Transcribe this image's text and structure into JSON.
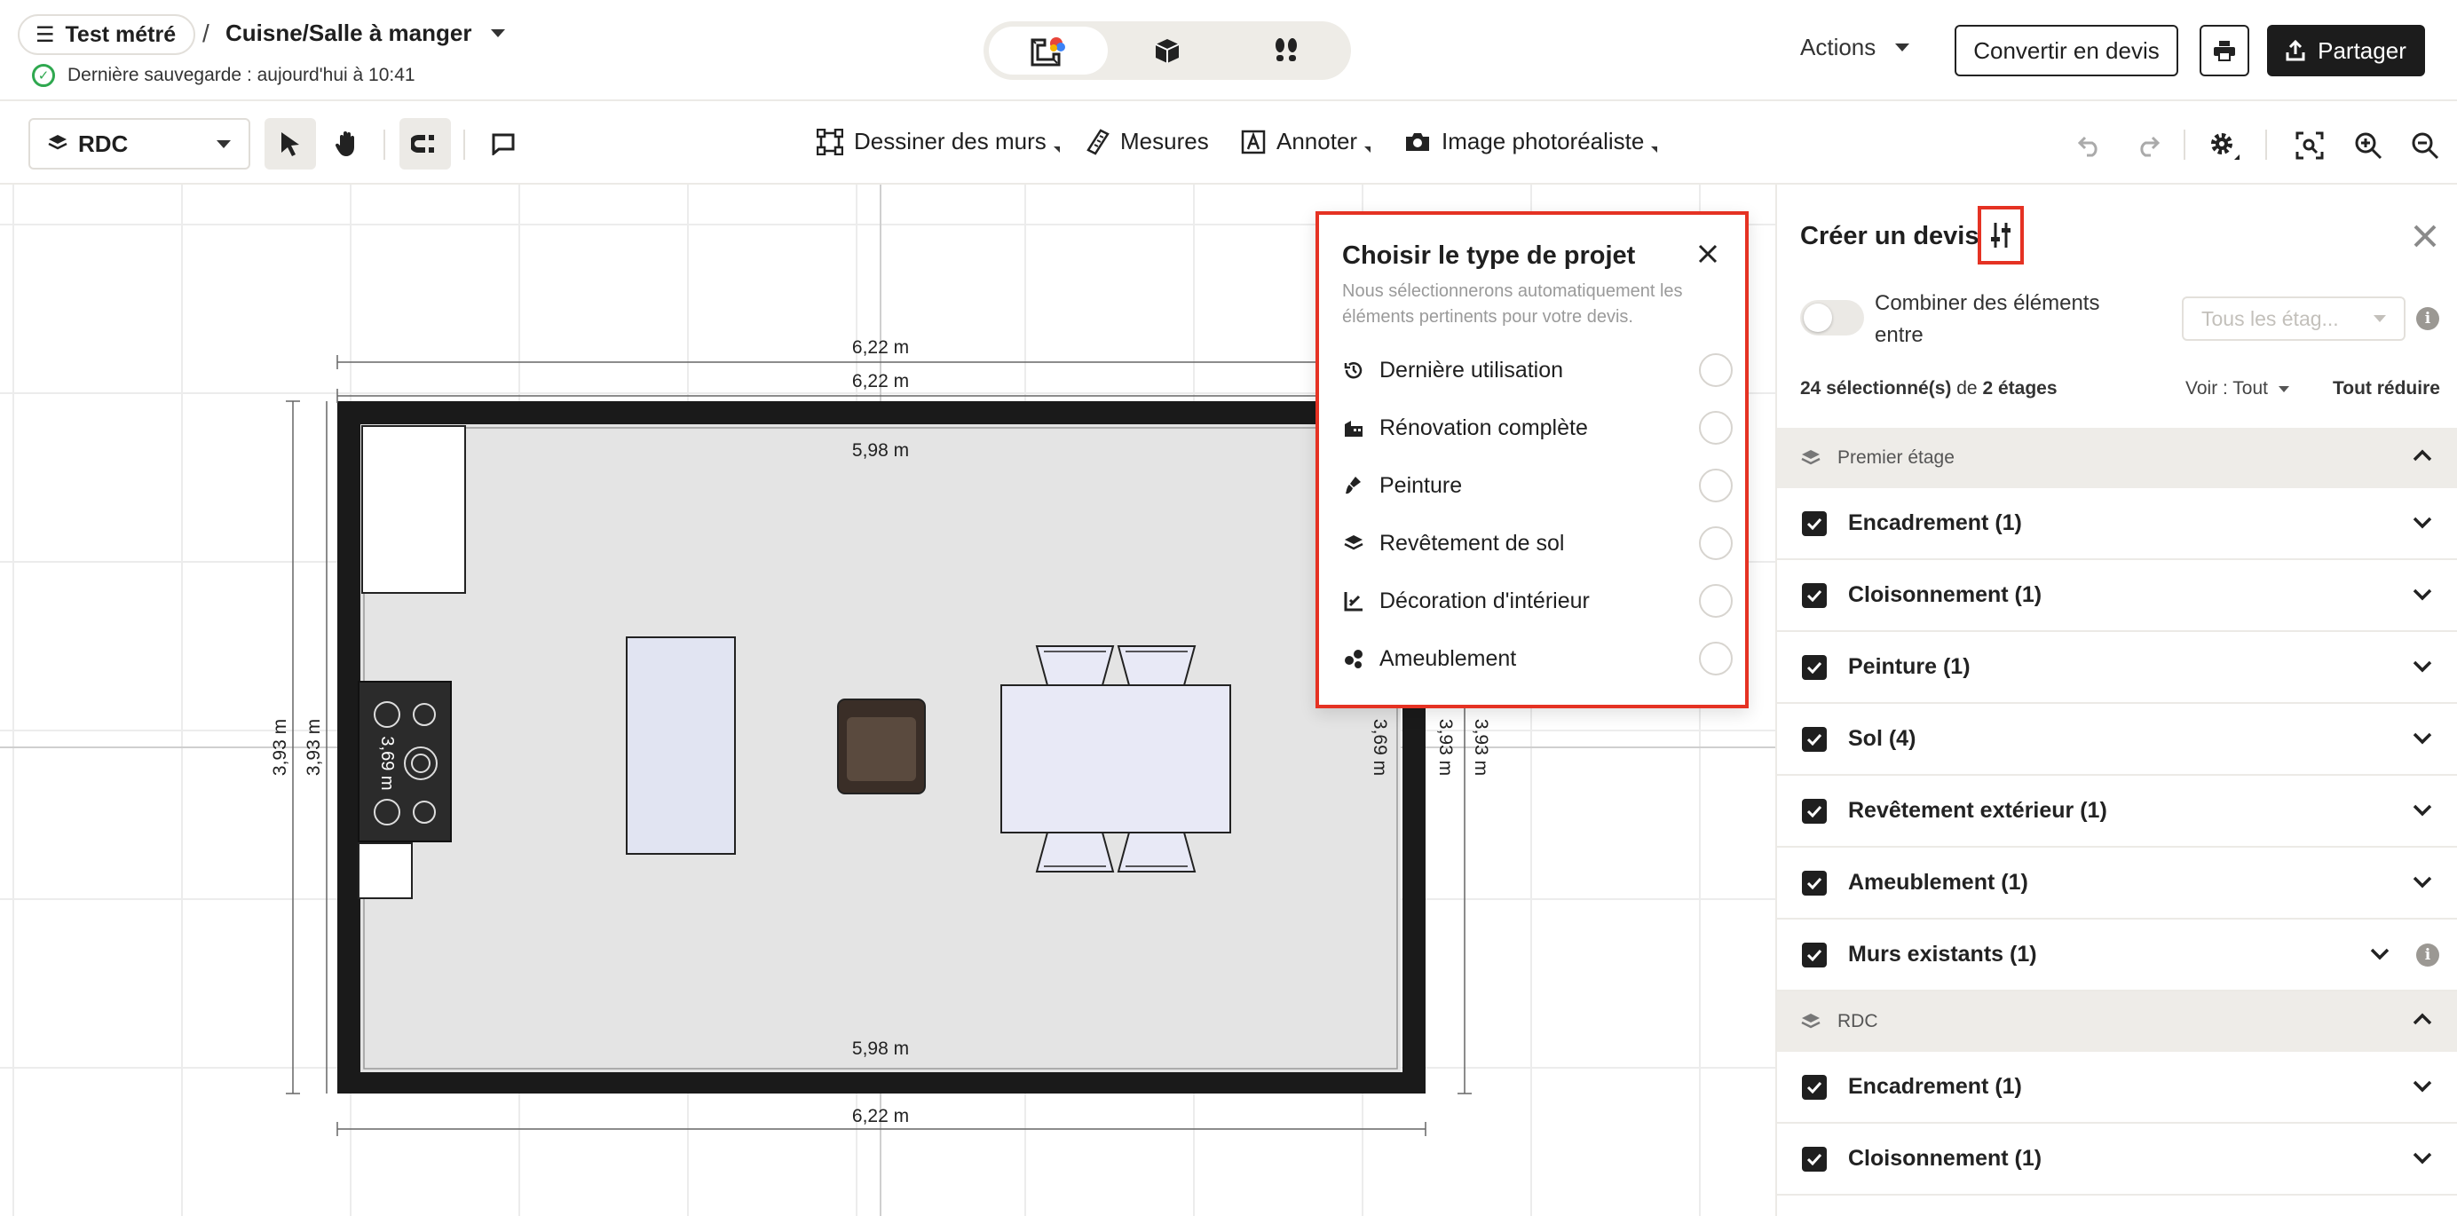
{
  "header": {
    "project_name": "Test métré",
    "breadcrumb_separator": "/",
    "room_name": "Cuisne/Salle à manger",
    "save_status": "Dernière sauvegarde : aujourd'hui à 10:41",
    "view_modes": [
      {
        "name": "2d-plan-icon",
        "active": true
      },
      {
        "name": "3d-box-icon",
        "active": false
      },
      {
        "name": "walkthrough-footprints-icon",
        "active": false
      }
    ],
    "actions_label": "Actions",
    "convert_label": "Convertir en devis",
    "share_label": "Partager"
  },
  "toolbar": {
    "level": "RDC",
    "draw_walls": "Dessiner des murs",
    "measures": "Mesures",
    "annotate": "Annoter",
    "photoreal": "Image photoréaliste"
  },
  "plan": {
    "dims": {
      "top_outer": "6,22 m",
      "top_inner_outer": "6,22 m",
      "top_inner": "5,98 m",
      "bottom_inner": "5,98 m",
      "bottom_outer": "6,22 m",
      "left_outer": "3,93 m",
      "left_inner": "3,93 m",
      "right_inner": "3,69 m",
      "right_mid": "3,93 m",
      "right_outer": "3,93 m"
    },
    "stove_label": "3,69 m"
  },
  "popup": {
    "title": "Choisir le type de projet",
    "subtitle": "Nous sélectionnerons automatiquement les éléments pertinents pour votre devis.",
    "options": [
      {
        "icon": "history-icon",
        "label": "Dernière utilisation"
      },
      {
        "icon": "building-icon",
        "label": "Rénovation complète"
      },
      {
        "icon": "paint-brush-icon",
        "label": "Peinture"
      },
      {
        "icon": "layers-icon",
        "label": "Revêtement de sol"
      },
      {
        "icon": "decoration-icon",
        "label": "Décoration d'intérieur"
      },
      {
        "icon": "furniture-icon",
        "label": "Ameublement"
      }
    ]
  },
  "panel": {
    "title": "Créer un devis",
    "combine_label": "Combiner des éléments entre",
    "floor_select": "Tous les étag...",
    "selected_count": "24 sélectionné(s)",
    "selected_of": "de",
    "selected_floors": "2 étages",
    "view_label": "Voir : Tout",
    "collapse_label": "Tout réduire",
    "groups": [
      {
        "name": "Premier étage",
        "items": [
          "Encadrement (1)",
          "Cloisonnement (1)",
          "Peinture (1)",
          "Sol (4)",
          "Revêtement extérieur (1)",
          "Ameublement (1)",
          "Murs existants (1)"
        ]
      },
      {
        "name": "RDC",
        "items": [
          "Encadrement (1)",
          "Cloisonnement (1)"
        ]
      }
    ]
  },
  "colors": {
    "accent_red": "#e53223",
    "success_green": "#2fa84f",
    "dark": "#1c1c1c",
    "panel_header_bg": "#eeece8"
  }
}
